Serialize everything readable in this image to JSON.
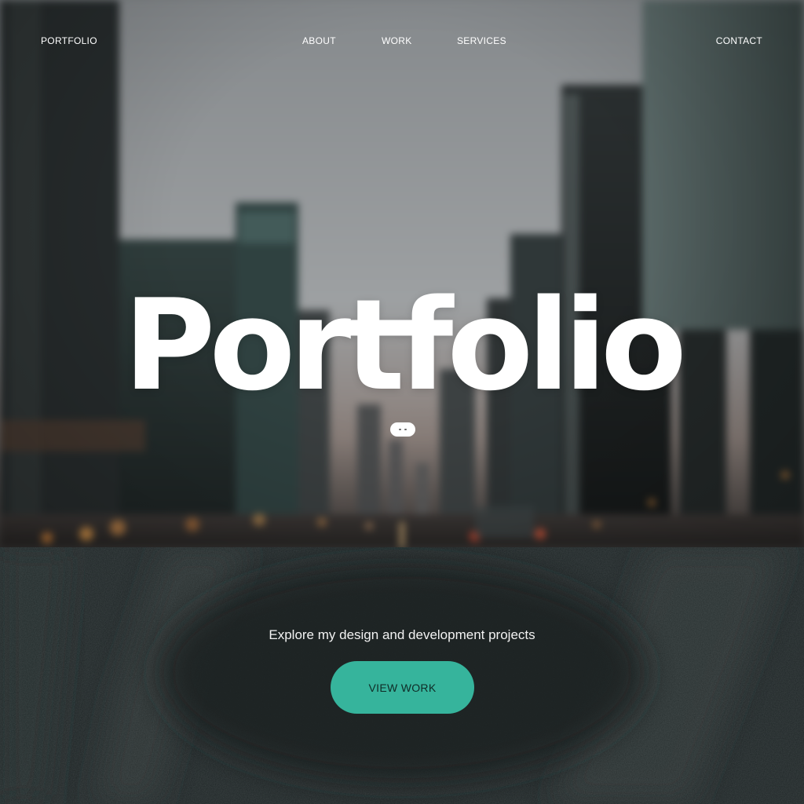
{
  "nav": {
    "logo": "PORTFOLIO",
    "about": "ABOUT",
    "work": "WORK",
    "services": "SERVICES",
    "contact": "CONTACT"
  },
  "hero": {
    "title": "Portfolio"
  },
  "intro": {
    "tagline": "Explore my design and development projects",
    "cta_label": "VIEW WORK"
  },
  "colors": {
    "accent": "#36b49c",
    "lower_background": "#1f2627",
    "text": "#ffffff"
  }
}
